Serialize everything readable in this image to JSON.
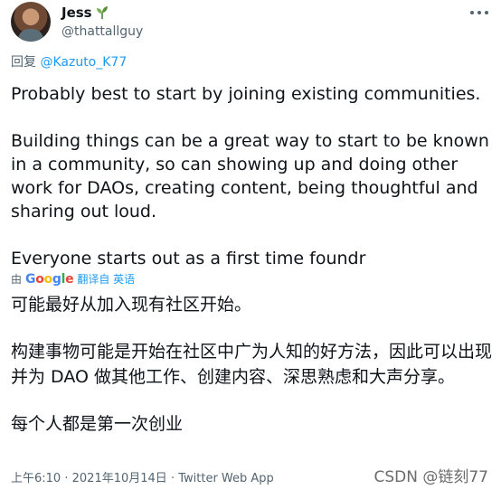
{
  "author": {
    "name": "Jess",
    "emoji": "🌱",
    "handle": "@thattallguy"
  },
  "reply": {
    "prefix": "回复",
    "mention": "@Kazuto_K77"
  },
  "tweet": {
    "paragraphs": [
      "Probably best to start by joining existing communities.",
      "Building things can be a great way to start to be known in a community, so can showing up and doing other work for DAOs, creating content, being thoughtful and sharing out loud.",
      "Everyone starts out as a first time foundr"
    ]
  },
  "translation": {
    "by_label": "由",
    "provider": "Google",
    "link_text": "翻译自 英语",
    "paragraphs": [
      "可能最好从加入现有社区开始。",
      "构建事物可能是开始在社区中广为人知的好方法，因此可以出现并为 DAO 做其他工作、创建内容、深思熟虑和大声分享。",
      "每个人都是第一次创业"
    ]
  },
  "meta": {
    "time": "上午6:10",
    "separator": "·",
    "date": "2021年10月14日",
    "source": "Twitter Web App"
  },
  "watermark": "CSDN @链刻77",
  "colors": {
    "link": "#1d9bf0",
    "secondary_text": "#536471",
    "primary_text": "#0f1419"
  }
}
